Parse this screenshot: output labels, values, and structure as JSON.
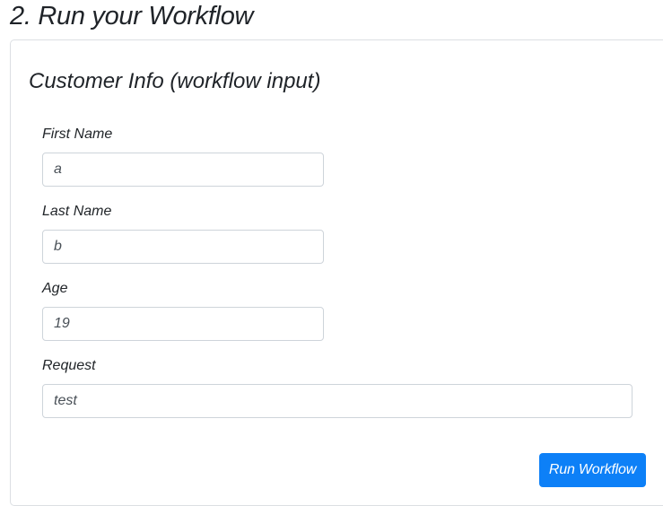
{
  "page": {
    "title": "2. Run your Workflow"
  },
  "form": {
    "title": "Customer Info (workflow input)",
    "fields": [
      {
        "label": "First Name",
        "value": "a"
      },
      {
        "label": "Last Name",
        "value": "b"
      },
      {
        "label": "Age",
        "value": "19"
      },
      {
        "label": "Request",
        "value": "test"
      }
    ],
    "submit_label": "Run Workflow"
  },
  "colors": {
    "accent": "#0d80f7",
    "border": "#ced4da",
    "card_border": "#dcdfe3"
  }
}
